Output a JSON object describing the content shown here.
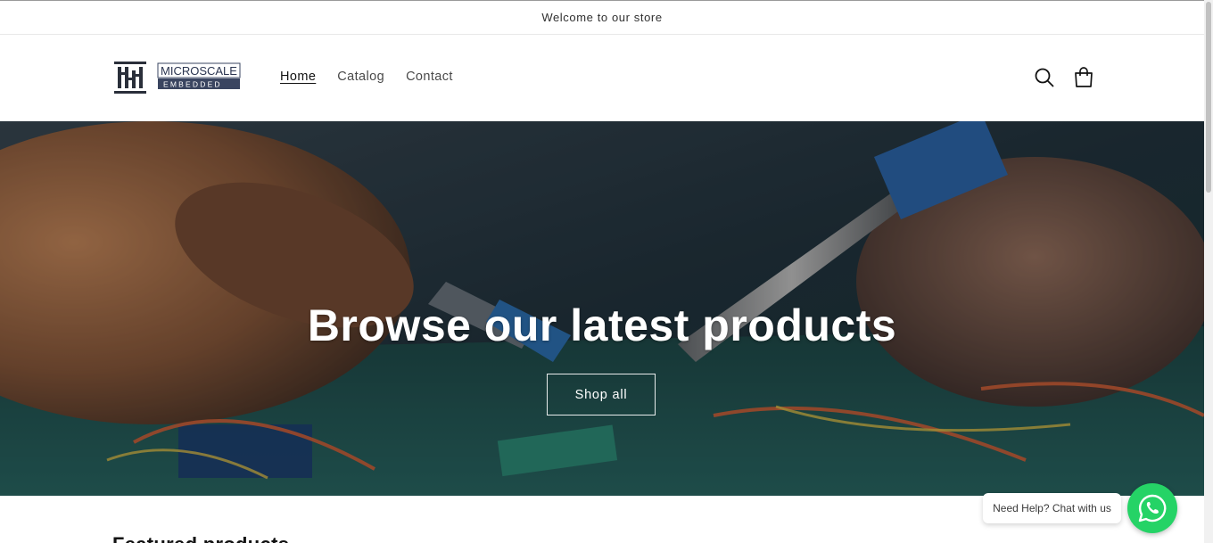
{
  "announcement": {
    "text": "Welcome to our store"
  },
  "header": {
    "logo": {
      "line1": "MICROSCALE",
      "line2": "EMBEDDED"
    },
    "nav": [
      {
        "label": "Home",
        "active": true
      },
      {
        "label": "Catalog",
        "active": false
      },
      {
        "label": "Contact",
        "active": false
      }
    ],
    "icons": [
      "search-icon",
      "cart-icon"
    ]
  },
  "hero": {
    "title": "Browse our latest products",
    "button_label": "Shop all"
  },
  "featured": {
    "title": "Featured products"
  },
  "chat_widget": {
    "bubble_text": "Need Help? Chat with us",
    "icon": "whatsapp-icon",
    "color": "#25d366"
  }
}
